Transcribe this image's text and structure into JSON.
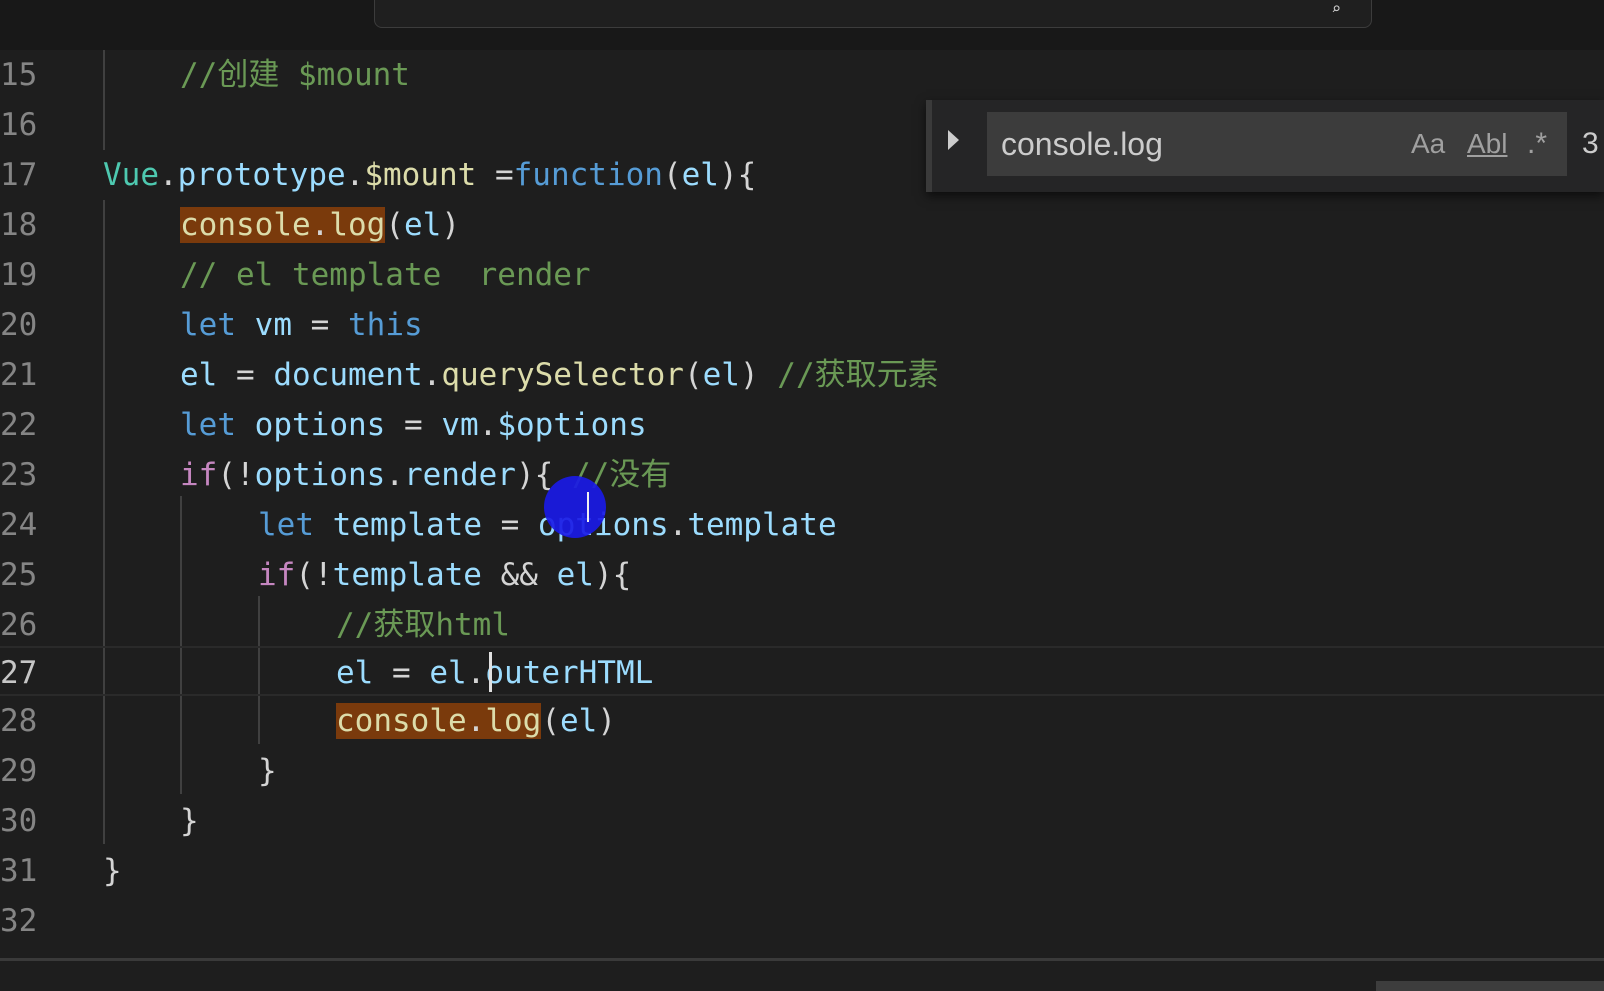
{
  "find": {
    "query": "console.log",
    "match_case_label": "Aa",
    "whole_word_label": "Abl",
    "regex_label": ".*",
    "count_text": "3"
  },
  "editor": {
    "current_line": "27",
    "lines": [
      {
        "num": "15",
        "tokens": [
          "//创建 $mount"
        ]
      },
      {
        "num": "16",
        "tokens": []
      },
      {
        "num": "17",
        "tokens": [
          "Vue",
          ".",
          "prototype",
          ".",
          "$mount",
          " =",
          "function",
          "(",
          "el",
          "){"
        ]
      },
      {
        "num": "18",
        "tokens": [
          "console",
          ".",
          "log",
          "(",
          "el",
          ")"
        ]
      },
      {
        "num": "19",
        "tokens": [
          "// el template  render"
        ]
      },
      {
        "num": "20",
        "tokens": [
          "let",
          " ",
          "vm",
          " = ",
          "this"
        ]
      },
      {
        "num": "21",
        "tokens": [
          "el",
          " = ",
          "document",
          ".",
          "querySelector",
          "(",
          "el",
          ") ",
          "//获取元素"
        ]
      },
      {
        "num": "22",
        "tokens": [
          "let",
          " ",
          "options",
          " = ",
          "vm",
          ".",
          "$options"
        ]
      },
      {
        "num": "23",
        "tokens": [
          "if",
          "(!",
          "options",
          ".",
          "render",
          "){ ",
          "//没有"
        ]
      },
      {
        "num": "24",
        "tokens": [
          "let",
          " ",
          "template",
          " = ",
          "options",
          ".",
          "template"
        ]
      },
      {
        "num": "25",
        "tokens": [
          "if",
          "(!",
          "template",
          " && ",
          "el",
          "){"
        ]
      },
      {
        "num": "26",
        "tokens": [
          "//获取html"
        ]
      },
      {
        "num": "27",
        "tokens": [
          "el",
          " = ",
          "el",
          ".",
          "outerHTML"
        ]
      },
      {
        "num": "28",
        "tokens": [
          "console",
          ".",
          "log",
          "(",
          "el",
          ")"
        ]
      },
      {
        "num": "29",
        "tokens": [
          "}"
        ]
      },
      {
        "num": "30",
        "tokens": [
          "}"
        ]
      },
      {
        "num": "31",
        "tokens": [
          "}"
        ]
      },
      {
        "num": "32",
        "tokens": []
      }
    ]
  },
  "colors": {
    "background": "#1e1e1e",
    "keyword": "#569cd6",
    "control": "#c586c0",
    "function": "#dcdcaa",
    "variable": "#9cdcfe",
    "class": "#4ec9b0",
    "comment": "#6a9955",
    "match_highlight": "#7a3a0c"
  }
}
